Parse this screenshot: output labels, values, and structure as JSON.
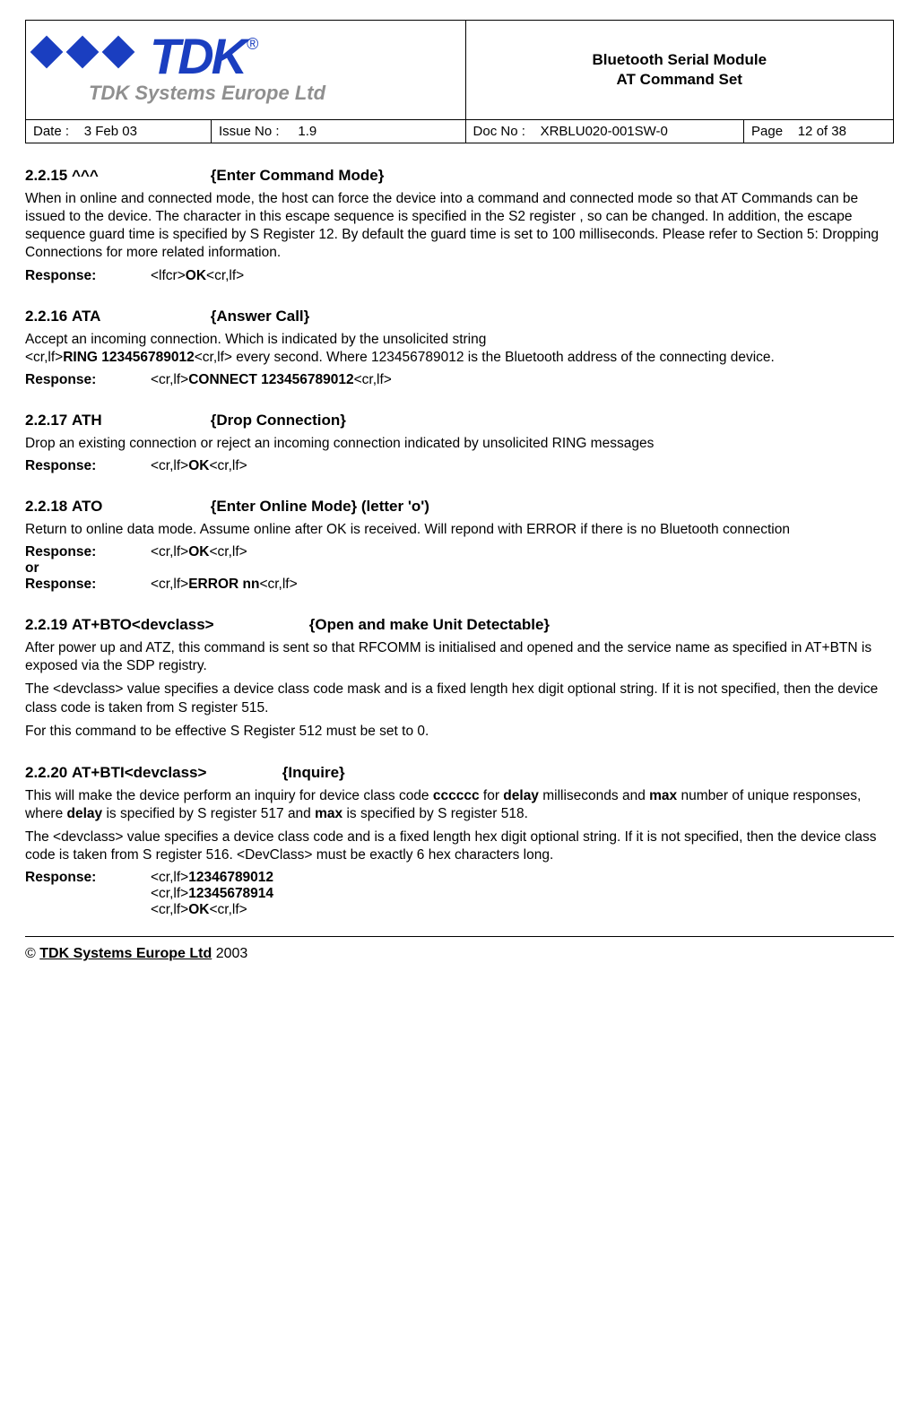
{
  "header": {
    "logo_main": "TDK",
    "logo_reg": "®",
    "logo_sub": "TDK Systems Europe Ltd",
    "title_l1": "Bluetooth Serial Module",
    "title_l2": "AT Command Set",
    "date_label": "Date :",
    "date_val": "3 Feb 03",
    "issue_label": "Issue No :",
    "issue_val": "1.9",
    "doc_label": "Doc No :",
    "doc_val": "XRBLU020-001SW-0",
    "page_label": "Page",
    "page_val": "12 of 38"
  },
  "s2215": {
    "num": "2.2.15",
    "cmd": "^^^",
    "name": "{Enter Command Mode}",
    "body": "When in online and connected mode, the host can force the device into a command and connected mode so that AT Commands can be issued to the device. The character in this escape sequence is specified in the S2 register , so can be changed. In addition, the escape sequence guard time is specified by S Register 12. By default the guard time is set to 100 milliseconds. Please refer to Section 5: Dropping Connections for more related information.",
    "resp_label": "Response:",
    "resp_pre": "<lfcr>",
    "resp_bold": "OK",
    "resp_post": "<cr,lf>"
  },
  "s2216": {
    "num": "2.2.16",
    "cmd": "ATA",
    "name": "{Answer Call}",
    "body1": "Accept an incoming connection. Which is indicated by the unsolicited string",
    "body2a": "<cr,lf>",
    "body2b": "RING 123456789012",
    "body2c": "<cr,lf> every second. Where 123456789012 is the Bluetooth address of the connecting device.",
    "resp_label": "Response:",
    "resp_pre": "<cr,lf>",
    "resp_bold": "CONNECT 123456789012",
    "resp_post": "<cr,lf>"
  },
  "s2217": {
    "num": "2.2.17",
    "cmd": "ATH",
    "name": "{Drop Connection}",
    "body": "Drop an existing connection or reject an incoming connection indicated by unsolicited RING messages",
    "resp_label": "Response:",
    "resp_pre": "<cr,lf>",
    "resp_bold": "OK",
    "resp_post": "<cr,lf>"
  },
  "s2218": {
    "num": "2.2.18",
    "cmd": "ATO",
    "name": "{Enter Online Mode}  (letter 'o')",
    "body": "Return to online data mode. Assume online after OK is received. Will repond with ERROR if there is no Bluetooth connection",
    "resp_label": "Response:",
    "resp1_pre": "<cr,lf>",
    "resp1_bold": "OK",
    "resp1_post": "<cr,lf>",
    "or": "or",
    "resp2_pre": "<cr,lf>",
    "resp2_bold": "ERROR nn",
    "resp2_post": "<cr,lf>"
  },
  "s2219": {
    "num": "2.2.19",
    "cmd": "AT+BTO<devclass>",
    "name": "{Open and make Unit Detectable}",
    "p1": "After power up and ATZ, this command is sent so that RFCOMM is initialised and opened and the service name as specified in AT+BTN is exposed via the SDP registry.",
    "p2": "The <devclass> value specifies a device class code mask and is a fixed length hex digit optional string. If it is not specified, then the device class code is taken from S register 515.",
    "p3": "For this command to be effective S Register 512 must be set to 0."
  },
  "s2220": {
    "num": "2.2.20",
    "cmd": "AT+BTI<devclass>",
    "name": "{Inquire}",
    "p1a": "This will make the device perform an inquiry for device class code ",
    "p1b": "cccccc",
    "p1c": " for ",
    "p1d": "delay",
    "p1e": " milliseconds and ",
    "p1f": "max",
    "p1g": " number of unique responses, where ",
    "p1h": "delay",
    "p1i": " is specified by S register 517 and ",
    "p1j": "max",
    "p1k": " is specified by S register 518.",
    "p2": "The <devclass> value specifies a device class code and is a fixed length hex digit optional string. If it is not specified, then the device class code is taken from S register 516. <DevClass> must be exactly 6 hex characters long.",
    "resp_label": "Response:",
    "r1_pre": "<cr,lf>",
    "r1_bold": "12346789012",
    "r2_pre": "<cr,lf>",
    "r2_bold": "12345678914",
    "r3_pre": "<cr,lf>",
    "r3_bold": "OK",
    "r3_post": "<cr,lf>"
  },
  "footer": {
    "copy": "© ",
    "company": "TDK Systems Europe Ltd",
    "year": " 2003"
  }
}
